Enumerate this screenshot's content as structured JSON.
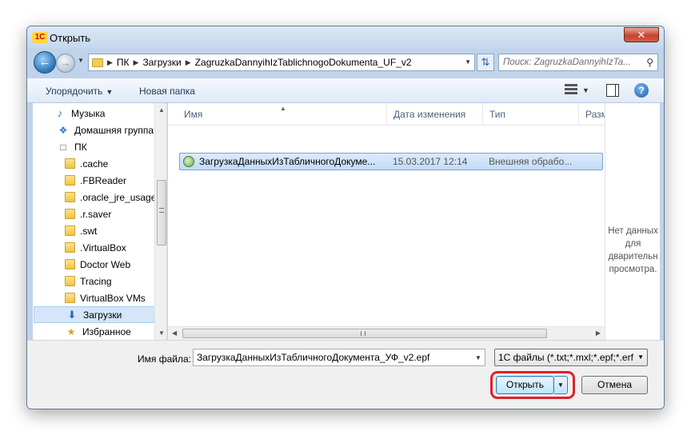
{
  "window": {
    "title": "Открыть",
    "app_logo": "1С",
    "close_glyph": "✕"
  },
  "nav": {
    "breadcrumbs": [
      "ПК",
      "Загрузки",
      "ZagruzkaDannyihIzTablichnogoDokumenta_UF_v2"
    ],
    "search_placeholder": "Поиск: ZagruzkaDannyihIzTa..."
  },
  "toolbar": {
    "organize": "Упорядочить",
    "new_folder": "Новая папка"
  },
  "sidebar": {
    "items": [
      {
        "label": "Музыка",
        "icon": "music-icon"
      },
      {
        "label": "Домашняя группа",
        "icon": "homegroup-icon"
      },
      {
        "label": "ПК",
        "icon": "computer-icon"
      },
      {
        "label": ".cache",
        "icon": "folder-icon"
      },
      {
        "label": ".FBReader",
        "icon": "folder-icon"
      },
      {
        "label": ".oracle_jre_usage",
        "icon": "folder-icon"
      },
      {
        "label": ".r.saver",
        "icon": "folder-icon"
      },
      {
        "label": ".swt",
        "icon": "folder-icon"
      },
      {
        "label": ".VirtualBox",
        "icon": "folder-icon"
      },
      {
        "label": "Doctor Web",
        "icon": "folder-icon"
      },
      {
        "label": "Tracing",
        "icon": "folder-icon"
      },
      {
        "label": "VirtualBox VMs",
        "icon": "folder-icon"
      },
      {
        "label": "Загрузки",
        "icon": "downloads-icon",
        "selected": true
      },
      {
        "label": "Избранное",
        "icon": "favorites-icon"
      }
    ]
  },
  "file_list": {
    "columns": [
      "Имя",
      "Дата изменения",
      "Тип",
      "Разм"
    ],
    "rows": [
      {
        "name": "ЗагрузкаДанныхИзТабличногоДокуме...",
        "date": "15.03.2017 12:14",
        "type": "Внешняя обрабо..."
      }
    ]
  },
  "preview": {
    "text": "Нет данных\nдля\nдварительн\nпросмотра."
  },
  "footer": {
    "filename_label": "Имя файла:",
    "filename_value": "ЗагрузкаДанныхИзТабличногоДокумента_УФ_v2.epf",
    "filter": "1С файлы (*.txt;*.mxl;*.epf;*.erf",
    "open_label": "Открыть",
    "cancel_label": "Отмена"
  },
  "colors": {
    "highlight": "#e0202a",
    "selection": "#c2dcf7",
    "frame": "#bfd3ea"
  }
}
